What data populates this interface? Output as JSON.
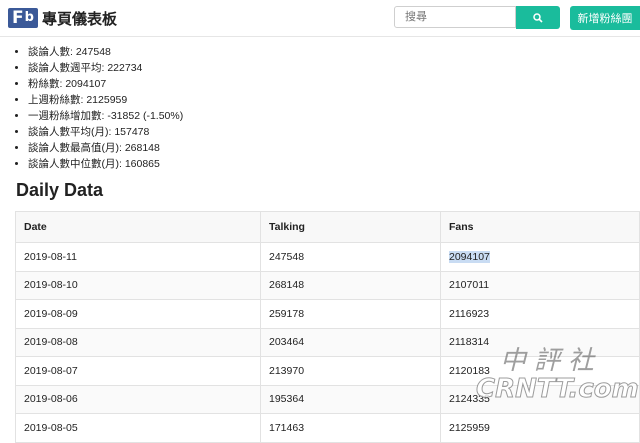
{
  "header": {
    "logo_f": "F",
    "logo_b": "b",
    "title": "專頁儀表板",
    "search_placeholder": "搜尋",
    "new_button": "新增粉絲團"
  },
  "stats": [
    "談論人數: 247548",
    "談論人數週平均: 222734",
    "粉絲數: 2094107",
    "上週粉絲數: 2125959",
    "一週粉絲增加數: -31852 (-1.50%)",
    "談論人數平均(月): 157478",
    "談論人數最高值(月): 268148",
    "談論人數中位數(月): 160865"
  ],
  "section_title": "Daily Data",
  "table": {
    "headers": [
      "Date",
      "Talking",
      "Fans"
    ],
    "rows": [
      [
        "2019-08-11",
        "247548",
        "2094107"
      ],
      [
        "2019-08-10",
        "268148",
        "2107011"
      ],
      [
        "2019-08-09",
        "259178",
        "2116923"
      ],
      [
        "2019-08-08",
        "203464",
        "2118314"
      ],
      [
        "2019-08-07",
        "213970",
        "2120183"
      ],
      [
        "2019-08-06",
        "195364",
        "2124335"
      ],
      [
        "2019-08-05",
        "171463",
        "2125959"
      ]
    ]
  },
  "watermark": {
    "cn": "中評社",
    "en": "CRNTT.com"
  },
  "colors": {
    "accent": "#1abc9c",
    "logo": "#3b5998",
    "highlight": "#c9dcf3"
  }
}
